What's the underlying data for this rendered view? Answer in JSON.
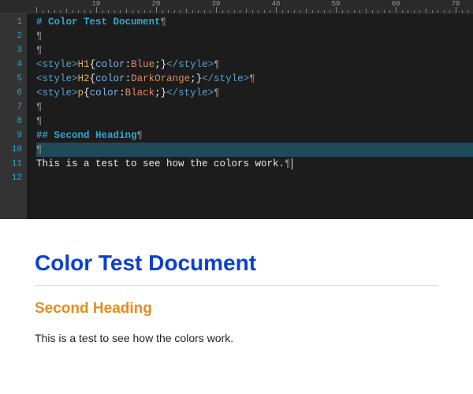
{
  "ruler": {
    "majors": [
      10,
      20,
      30,
      40,
      50,
      60,
      70
    ]
  },
  "editor": {
    "line_count": 12,
    "lines": [
      {
        "n": 1,
        "type": "md-h1",
        "prefix": "# ",
        "text": "Color Test Document"
      },
      {
        "n": 2,
        "type": "blank"
      },
      {
        "n": 3,
        "type": "blank"
      },
      {
        "n": 4,
        "type": "style",
        "selector": "H1",
        "prop": "color",
        "value": "Blue"
      },
      {
        "n": 5,
        "type": "style",
        "selector": "H2",
        "prop": "color",
        "value": "DarkOrange"
      },
      {
        "n": 6,
        "type": "style",
        "selector": "p",
        "prop": "color",
        "value": "Black"
      },
      {
        "n": 7,
        "type": "blank"
      },
      {
        "n": 8,
        "type": "blank"
      },
      {
        "n": 9,
        "type": "md-h2",
        "prefix": "## ",
        "text": "Second Heading"
      },
      {
        "n": 10,
        "type": "blank",
        "selected": true
      },
      {
        "n": 11,
        "type": "text",
        "text": "This is a test to see how the colors work.",
        "cursor_after": true
      },
      {
        "n": 12,
        "type": "empty"
      }
    ],
    "style_tag_open": "<style>",
    "style_tag_close": "</style>",
    "paragraph_mark": "¶"
  },
  "preview": {
    "h1": "Color Test Document",
    "h2": "Second Heading",
    "p": "This is a test to see how the colors work.",
    "colors": {
      "h1": "#0b3fd6",
      "h2": "#e88b1a",
      "p": "#222222"
    }
  }
}
